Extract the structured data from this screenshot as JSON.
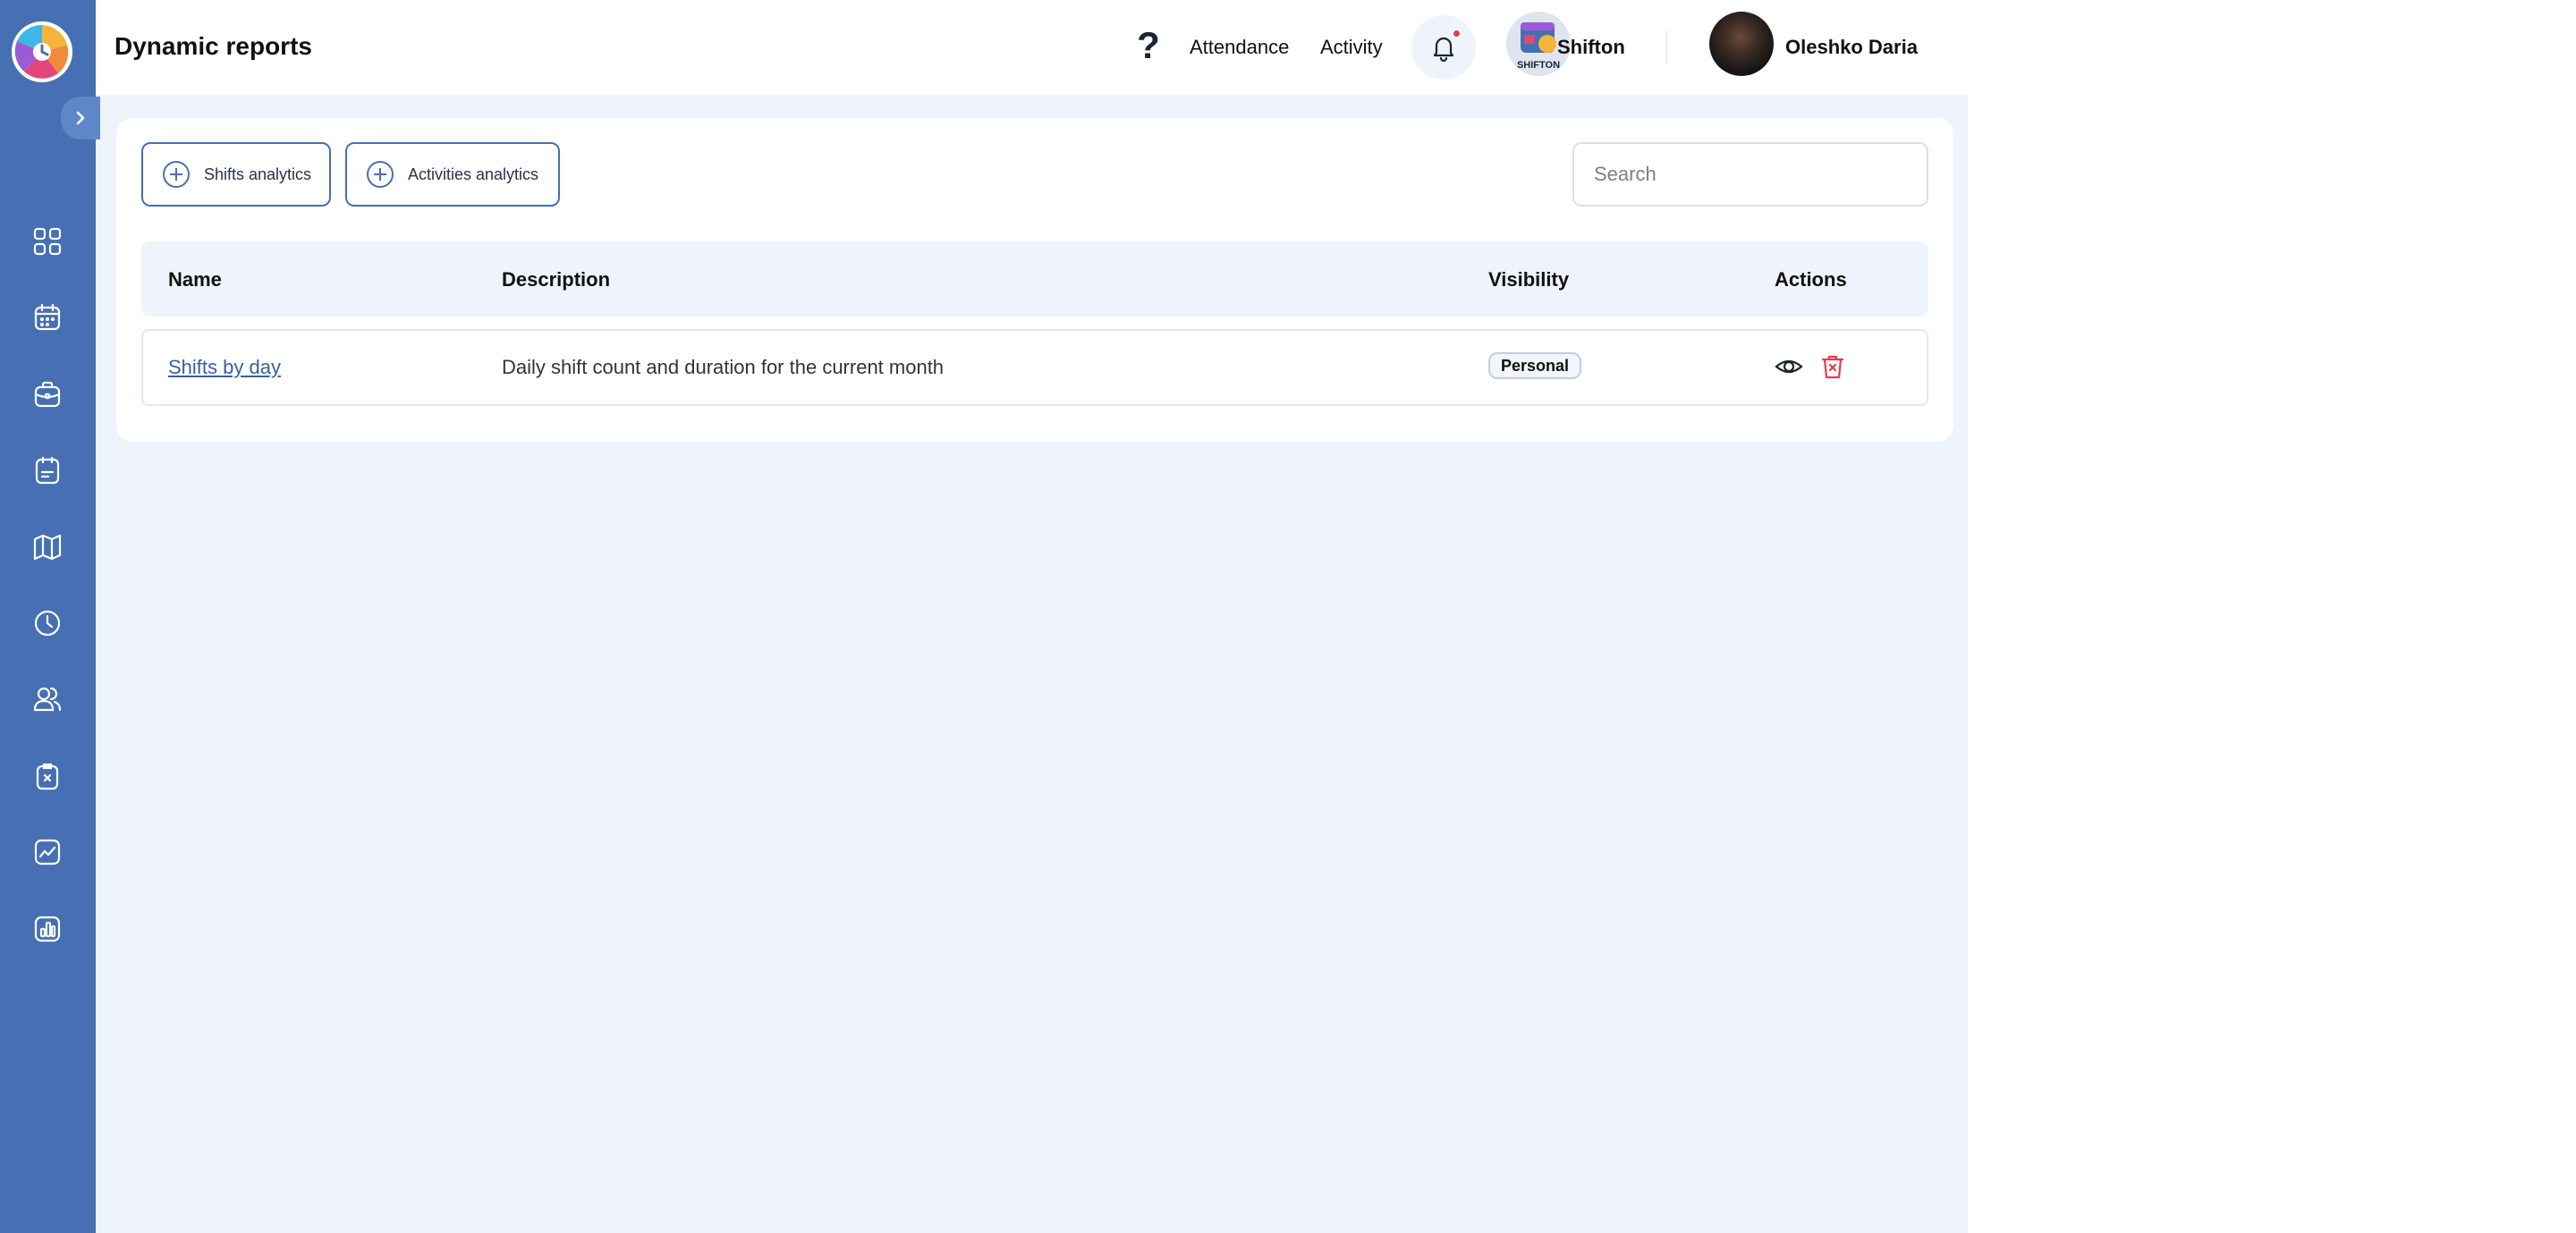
{
  "header": {
    "title": "Dynamic reports",
    "nav": {
      "attendance": "Attendance",
      "activity": "Activity"
    },
    "help_symbol": "?",
    "company": {
      "name": "Shifton",
      "logo_text": "SHIFTON"
    },
    "user": {
      "name": "Oleshko Daria"
    }
  },
  "sidebar": {
    "items": [
      {
        "icon": "dashboard-icon"
      },
      {
        "icon": "calendar-icon"
      },
      {
        "icon": "briefcase-icon"
      },
      {
        "icon": "clipboard-calendar-icon"
      },
      {
        "icon": "map-icon"
      },
      {
        "icon": "clock-icon"
      },
      {
        "icon": "users-icon"
      },
      {
        "icon": "time-clipboard-icon"
      },
      {
        "icon": "chart-line-icon"
      },
      {
        "icon": "bar-chart-icon"
      }
    ]
  },
  "toolbar": {
    "shifts_analytics_label": "Shifts analytics",
    "activities_analytics_label": "Activities analytics",
    "search_placeholder": "Search"
  },
  "table": {
    "columns": [
      "Name",
      "Description",
      "Visibility",
      "Actions"
    ],
    "rows": [
      {
        "name": "Shifts by day",
        "description": "Daily shift count and duration for the current month",
        "visibility": "Personal",
        "actions": [
          "eye-icon",
          "trash-icon"
        ]
      }
    ]
  },
  "colors": {
    "sidebar": "#4670b3",
    "accent": "#4670b3",
    "background": "#eef3fc",
    "danger": "#e63950",
    "link": "#3a5fa0"
  }
}
